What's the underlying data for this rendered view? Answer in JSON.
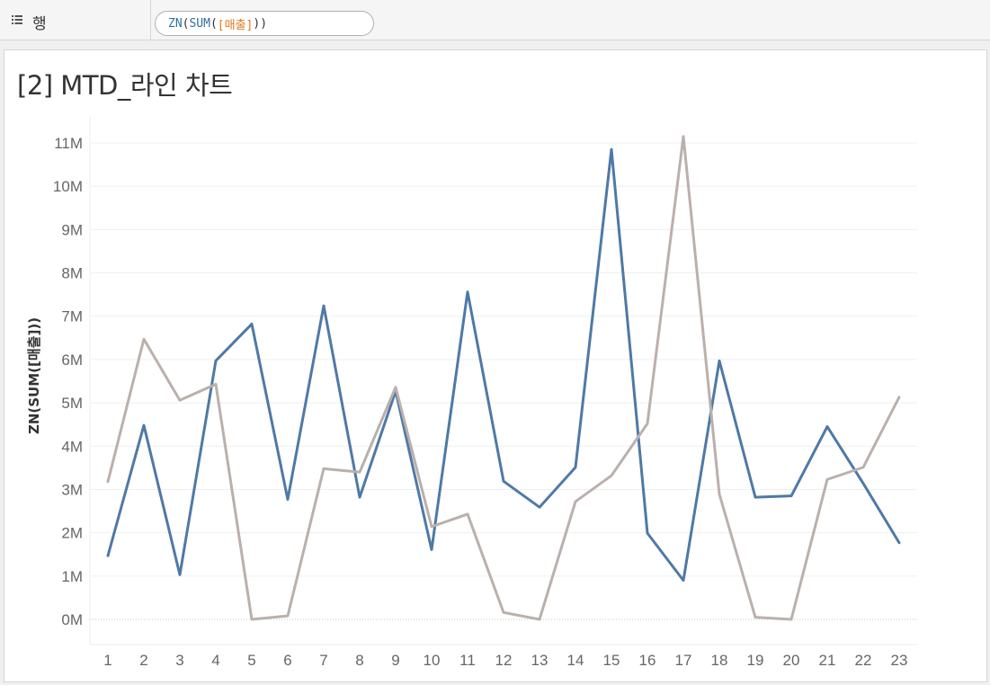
{
  "shelf": {
    "label": "행",
    "pill": {
      "fn1": "ZN",
      "fn2": "SUM",
      "field": "[매출]"
    }
  },
  "sheet": {
    "title": "[2] MTD_라인 차트"
  },
  "chart_data": {
    "type": "line",
    "title": "[2] MTD_라인 차트",
    "xlabel": "",
    "ylabel": "ZN(SUM([매출]))",
    "x": [
      1,
      2,
      3,
      4,
      5,
      6,
      7,
      8,
      9,
      10,
      11,
      12,
      13,
      14,
      15,
      16,
      17,
      18,
      19,
      20,
      21,
      22,
      23
    ],
    "ylim": [
      -0.6,
      11.6
    ],
    "yticks": [
      0,
      1,
      2,
      3,
      4,
      5,
      6,
      7,
      8,
      9,
      10,
      11
    ],
    "yticklabels": [
      "0M",
      "1M",
      "2M",
      "3M",
      "4M",
      "5M",
      "6M",
      "7M",
      "8M",
      "9M",
      "10M",
      "11M"
    ],
    "grid": true,
    "legend": "none",
    "series": [
      {
        "color": "#4e79a7",
        "values": [
          1.47,
          4.48,
          1.03,
          5.97,
          6.82,
          2.77,
          7.24,
          2.82,
          5.27,
          1.61,
          7.56,
          3.19,
          2.59,
          3.51,
          10.85,
          1.99,
          0.9,
          5.97,
          2.82,
          2.85,
          4.45,
          3.14,
          1.77
        ]
      },
      {
        "color": "#bab0ac",
        "values": [
          3.18,
          6.47,
          5.06,
          5.43,
          0.0,
          0.08,
          3.48,
          3.4,
          5.36,
          2.14,
          2.43,
          0.16,
          0.0,
          2.72,
          3.32,
          4.52,
          11.15,
          2.89,
          0.05,
          0.0,
          3.23,
          3.51,
          5.13
        ]
      }
    ]
  }
}
